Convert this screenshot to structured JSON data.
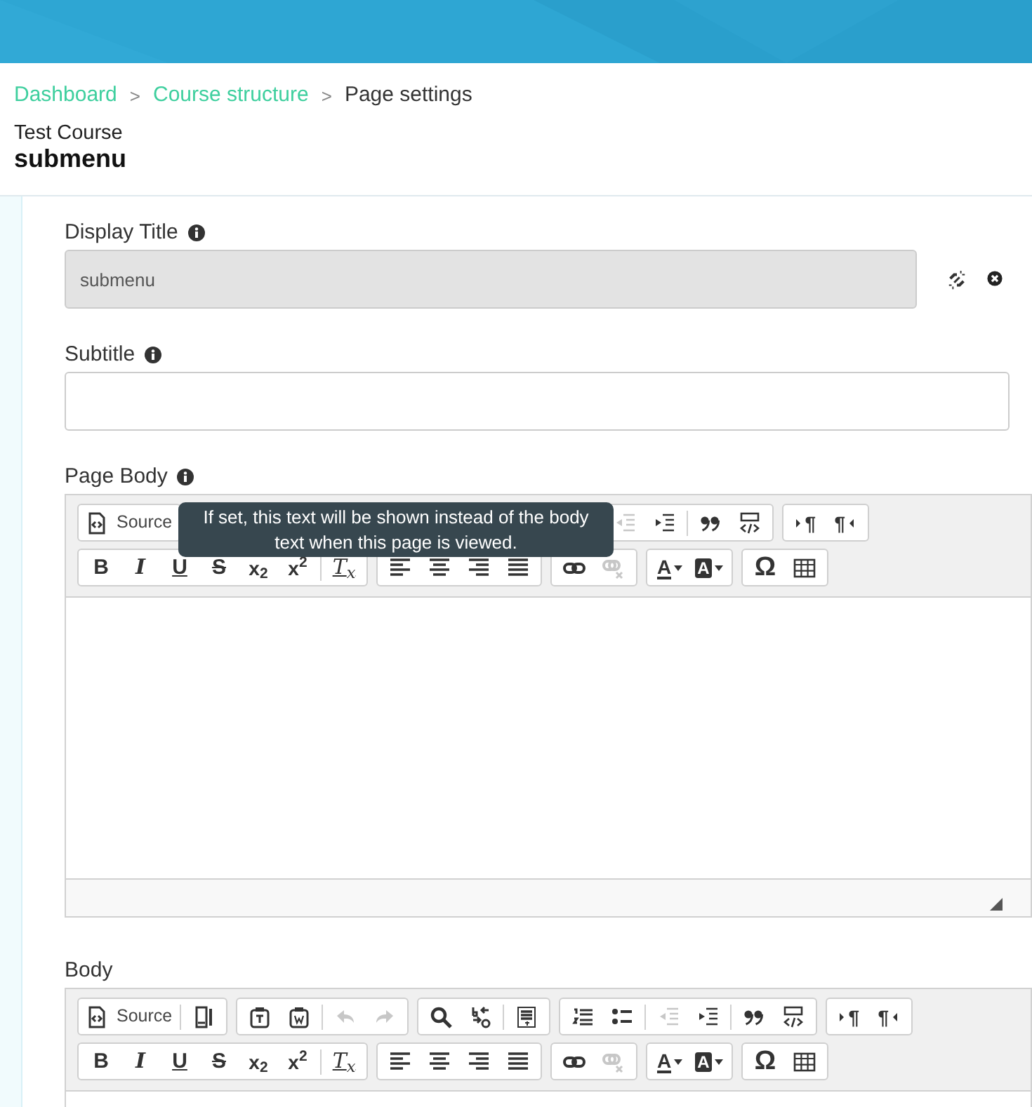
{
  "breadcrumb": [
    {
      "label": "Dashboard",
      "link": true,
      "separator": ">"
    },
    {
      "label": "Course structure",
      "link": true,
      "separator": ">"
    },
    {
      "label": "Page settings",
      "link": false
    }
  ],
  "course": "Test Course",
  "page_title": "submenu",
  "fields": [
    {
      "kind": "input",
      "label": "Display Title",
      "info": true,
      "value": "submenu",
      "disabled": true,
      "actions": [
        {
          "kind": "unlink"
        },
        {
          "kind": "clear"
        }
      ]
    },
    {
      "kind": "input",
      "label": "Subtitle",
      "info": true,
      "disabled": false
    },
    {
      "kind": "editor",
      "label": "Page Body",
      "info": true,
      "resizable": true,
      "tooltip": "If set, this text will be shown instead of the body text when this page is viewed.",
      "toolbar": [
        [
          [
            {
              "kind": "source",
              "label": "Source",
              "disabled": false
            }
          ],
          [
            {
              "kind": "outdent",
              "disabled": true
            },
            {
              "kind": "indent",
              "disabled": false
            },
            {
              "kind": "blockquote",
              "disabled": false,
              "sep": true
            },
            {
              "kind": "div",
              "disabled": false
            }
          ],
          [
            {
              "kind": "ltr",
              "glyph": "¶",
              "disabled": false
            },
            {
              "kind": "rtl",
              "glyph": "¶",
              "disabled": false
            }
          ]
        ],
        [
          [
            {
              "kind": "bold",
              "glyph": "B",
              "disabled": false
            },
            {
              "kind": "italic",
              "glyph": "I",
              "disabled": false
            },
            {
              "kind": "underline",
              "glyph": "U",
              "disabled": false
            },
            {
              "kind": "strike",
              "glyph": "S",
              "disabled": false
            },
            {
              "kind": "subscript",
              "glyph": "x$_{2}$",
              "disabled": false
            },
            {
              "kind": "superscript",
              "glyph": "x$^{2}$",
              "disabled": false
            },
            {
              "kind": "remove-format",
              "glyph": "T$_{x}$",
              "disabled": false,
              "sep": true
            }
          ],
          [
            {
              "kind": "align-left",
              "disabled": false
            },
            {
              "kind": "align-center",
              "disabled": false
            },
            {
              "kind": "align-right",
              "disabled": false
            },
            {
              "kind": "justify",
              "disabled": false
            }
          ],
          [
            {
              "kind": "link",
              "disabled": false
            },
            {
              "kind": "unlink",
              "disabled": true
            }
          ],
          [
            {
              "kind": "text-color",
              "glyph": "A",
              "disabled": false
            },
            {
              "kind": "bg-color",
              "glyph": "A",
              "disabled": false
            }
          ],
          [
            {
              "kind": "special-char",
              "glyph": "Ω",
              "disabled": false
            },
            {
              "kind": "table",
              "disabled": false
            }
          ]
        ]
      ]
    },
    {
      "kind": "editor",
      "label": "Body",
      "toolbar": [
        [
          [
            {
              "kind": "source",
              "label": "Source",
              "disabled": false
            },
            {
              "kind": "show-blocks",
              "disabled": false,
              "sep": true
            }
          ],
          [
            {
              "kind": "paste-text",
              "disabled": false
            },
            {
              "kind": "paste-word",
              "disabled": false
            },
            {
              "kind": "undo",
              "disabled": true,
              "sep": true
            },
            {
              "kind": "redo",
              "disabled": true
            }
          ],
          [
            {
              "kind": "find",
              "disabled": false
            },
            {
              "kind": "replace",
              "disabled": false
            },
            {
              "kind": "select-all",
              "disabled": false,
              "sep": true
            }
          ],
          [
            {
              "kind": "numbered-list",
              "disabled": false
            },
            {
              "kind": "bulleted-list",
              "disabled": false
            },
            {
              "kind": "outdent",
              "disabled": true,
              "sep": true
            },
            {
              "kind": "indent",
              "disabled": false
            },
            {
              "kind": "blockquote",
              "disabled": false,
              "sep": true
            },
            {
              "kind": "div",
              "disabled": false
            }
          ],
          [
            {
              "kind": "ltr",
              "glyph": "¶",
              "disabled": false
            },
            {
              "kind": "rtl",
              "glyph": "¶",
              "disabled": false
            }
          ]
        ],
        [
          [
            {
              "kind": "bold",
              "glyph": "B",
              "disabled": false
            },
            {
              "kind": "italic",
              "glyph": "I",
              "disabled": false
            },
            {
              "kind": "underline",
              "glyph": "U",
              "disabled": false
            },
            {
              "kind": "strike",
              "glyph": "S",
              "disabled": false
            },
            {
              "kind": "subscript",
              "glyph": "x$_{2}$",
              "disabled": false
            },
            {
              "kind": "superscript",
              "glyph": "x$^{2}$",
              "disabled": false
            },
            {
              "kind": "remove-format",
              "glyph": "T$_{x}$",
              "disabled": false,
              "sep": true
            }
          ],
          [
            {
              "kind": "align-left",
              "disabled": false
            },
            {
              "kind": "align-center",
              "disabled": false
            },
            {
              "kind": "align-right",
              "disabled": false
            },
            {
              "kind": "justify",
              "disabled": false
            }
          ],
          [
            {
              "kind": "link",
              "disabled": false
            },
            {
              "kind": "unlink",
              "disabled": true
            }
          ],
          [
            {
              "kind": "text-color",
              "glyph": "A",
              "disabled": false
            },
            {
              "kind": "bg-color",
              "glyph": "A",
              "disabled": false
            }
          ],
          [
            {
              "kind": "special-char",
              "glyph": "Ω",
              "disabled": false
            },
            {
              "kind": "table",
              "disabled": false
            }
          ]
        ]
      ]
    }
  ]
}
